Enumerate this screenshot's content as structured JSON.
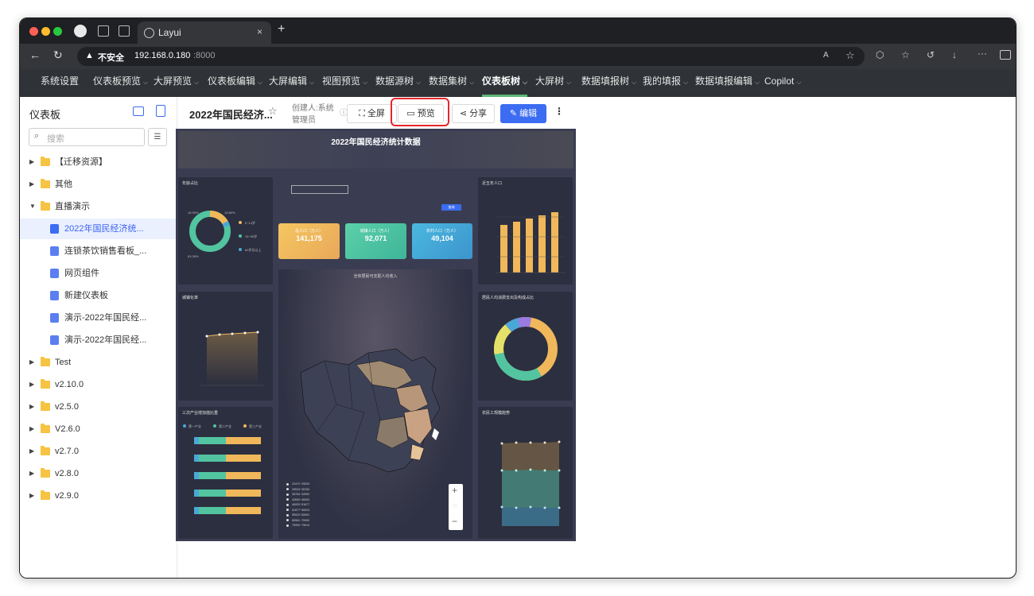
{
  "browser": {
    "tab_title": "Layui",
    "not_secure": "不安全",
    "url_host": "192.168.0.180",
    "url_port": ":8000"
  },
  "nav": {
    "items": [
      {
        "label": "系统设置",
        "dropdown": false
      },
      {
        "label": "仪表板预览",
        "dropdown": true
      },
      {
        "label": "大屏预览",
        "dropdown": true
      },
      {
        "label": "仪表板编辑",
        "dropdown": true
      },
      {
        "label": "大屏编辑",
        "dropdown": true
      },
      {
        "label": "视图预览",
        "dropdown": true
      },
      {
        "label": "数据源树",
        "dropdown": true
      },
      {
        "label": "数据集树",
        "dropdown": true
      },
      {
        "label": "仪表板树",
        "dropdown": true,
        "active": true
      },
      {
        "label": "大屏树",
        "dropdown": true
      },
      {
        "label": "数据填报树",
        "dropdown": true
      },
      {
        "label": "我的填报",
        "dropdown": true
      },
      {
        "label": "数据填报编辑",
        "dropdown": true
      },
      {
        "label": "Copilot",
        "dropdown": true
      }
    ]
  },
  "sidebar": {
    "title": "仪表板",
    "search_placeholder": "搜索",
    "tree": [
      {
        "label": "【迁移资源】",
        "type": "folder",
        "level": 0
      },
      {
        "label": "其他",
        "type": "folder",
        "level": 0
      },
      {
        "label": "直播演示",
        "type": "folder",
        "level": 0,
        "expanded": true
      },
      {
        "label": "2022年国民经济统...",
        "type": "doc",
        "level": 1,
        "selected": true
      },
      {
        "label": "连锁茶饮销售看板_...",
        "type": "doc",
        "level": 1
      },
      {
        "label": "网页组件",
        "type": "doc",
        "level": 1
      },
      {
        "label": "新建仪表板",
        "type": "doc",
        "level": 1
      },
      {
        "label": "演示-2022年国民经...",
        "type": "doc",
        "level": 1
      },
      {
        "label": "演示-2022年国民经...",
        "type": "doc",
        "level": 1
      },
      {
        "label": "Test",
        "type": "folder",
        "level": 0
      },
      {
        "label": "v2.10.0",
        "type": "folder",
        "level": 0
      },
      {
        "label": "v2.5.0",
        "type": "folder",
        "level": 0
      },
      {
        "label": "V2.6.0",
        "type": "folder",
        "level": 0
      },
      {
        "label": "v2.7.0",
        "type": "folder",
        "level": 0
      },
      {
        "label": "v2.8.0",
        "type": "folder",
        "level": 0
      },
      {
        "label": "v2.9.0",
        "type": "folder",
        "level": 0
      }
    ]
  },
  "toolbar": {
    "title": "2022年国民经济...",
    "creator_line1": "创建人:系统",
    "creator_line2": "管理员",
    "fullscreen_label": "全屏",
    "preview_label": "预览",
    "share_label": "分享",
    "edit_label": "编辑",
    "highlight_color": "#e5262c",
    "edit_color": "#3b6cf2"
  },
  "dashboard": {
    "title": "2022年国民经济统计数据",
    "panel_titles": {
      "age": "年龄占比",
      "urbanization": "城镇化率",
      "industry": "三次产业增加值比重",
      "population5": "近五年人口",
      "consumption": "居民人均消费支出及构成占比",
      "migrant": "农民工规模趋势",
      "map": "全体居民可支配人均收入"
    },
    "kpis": [
      {
        "label": "总人口（万人）",
        "value": "141,175",
        "color": "#f0b85a"
      },
      {
        "label": "城镇人口（万人）",
        "value": "92,071",
        "color": "#52c4a0"
      },
      {
        "label": "农村人口（万人）",
        "value": "49,104",
        "color": "#4aa8d8"
      }
    ],
    "query_button": "查询",
    "age_legend": [
      "0~14岁",
      "15~59岁",
      "60岁及以上"
    ],
    "age_pcts": [
      "16.95%",
      "19.80%",
      "63.35%"
    ],
    "industry_legend": [
      "第一产业",
      "第二产业",
      "第三产业"
    ],
    "map_legend": [
      "22472~29533",
      "29533~35784",
      "35784~42693",
      "42693~46053",
      "46053~51677",
      "51677~55923",
      "55923~65961",
      "65961~75900",
      "75900~79610"
    ],
    "map_zoom_in": "+",
    "map_zoom_out": "−"
  }
}
